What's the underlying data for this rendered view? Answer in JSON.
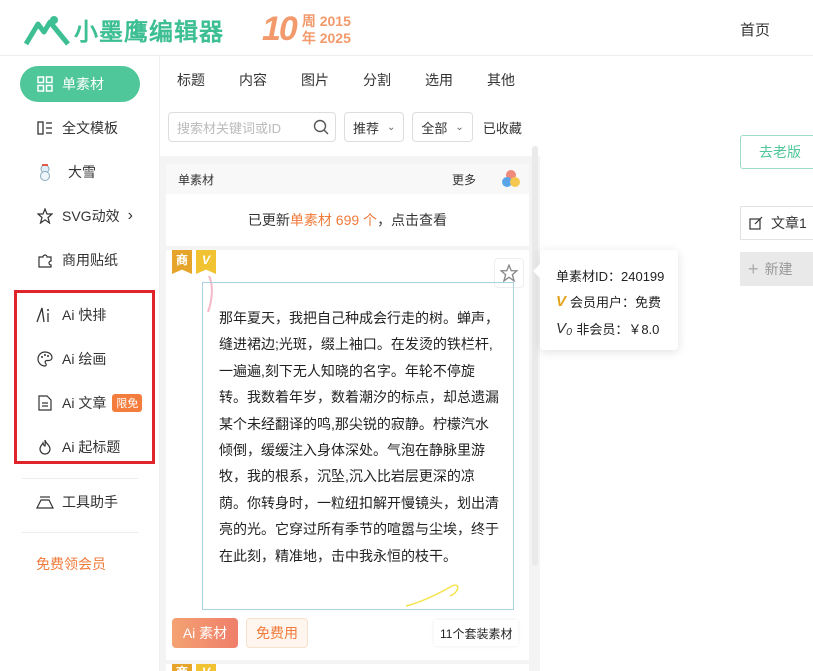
{
  "header": {
    "logo_text": "小墨鹰编辑器",
    "anniversary_number": "10",
    "anniversary_line1": "周 2015",
    "anniversary_line2": "年 2025",
    "home_link": "首页"
  },
  "sidebar": {
    "items": [
      {
        "label": "单素材",
        "icon": "grid-icon"
      },
      {
        "label": "全文模板",
        "icon": "template-icon"
      },
      {
        "label": "大雪",
        "icon": "snowman-icon"
      },
      {
        "label": "SVG动效",
        "icon": "star-outline-icon"
      },
      {
        "label": "商用贴纸",
        "icon": "puzzle-icon"
      },
      {
        "label": "Ai 快排",
        "icon": "ai-layout-icon"
      },
      {
        "label": "Ai 绘画",
        "icon": "palette-icon"
      },
      {
        "label": "Ai 文章",
        "icon": "document-icon",
        "badge": "限免"
      },
      {
        "label": "Ai 起标题",
        "icon": "flame-icon"
      },
      {
        "label": "工具助手",
        "icon": "toolbox-icon"
      }
    ],
    "svg_chevron": "›",
    "vip_link": "免费领会员"
  },
  "panel": {
    "tabs": [
      "标题",
      "内容",
      "图片",
      "分割",
      "选用",
      "其他"
    ],
    "search_placeholder": "搜索材关键词或ID",
    "sort_select": "推荐",
    "filter_select": "全部",
    "favorites": "已收藏",
    "list_title": "单素材",
    "more": "更多",
    "update_prefix": "已更新 ",
    "update_highlight": "单素材 699 个",
    "update_suffix": "，点击查看",
    "card": {
      "tag_commercial": "商",
      "tag_vip": "V",
      "text": "那年夏天，我把自己种成会行走的树。蝉声，缝进裙边;光斑，缀上袖口。在发烫的铁栏杆,一遍遍,刻下无人知晓的名字。年轮不停旋转。我数着年岁，数着潮汐的标点，却总遗漏某个未经翻译的鸣,那尖锐的寂静。柠檬汽水倾倒，缓缓注入身体深处。气泡在静脉里游牧，我的根系，沉坠,沉入比岩层更深的凉荫。你转身时，一粒纽扣解开慢镜头，划出清亮的光。它穿过所有季节的喧嚣与尘埃，终于在此刻，精准地，击中我永恒的枝干。",
      "ai_tag": "Ai 素材",
      "free_tag": "免费用",
      "set_tag": "11个套装素材"
    }
  },
  "tooltip": {
    "id_line": "单素材ID：240199",
    "member_mark": "V",
    "member_line": "会员用户：免费",
    "nonmember_mark": "V₀",
    "nonmember_line": "非会员：￥8.0"
  },
  "editor": {
    "old_version": "去老版",
    "doc_tab": "文章1",
    "new_doc": "新建"
  },
  "colors": {
    "brand_green": "#4fc79a",
    "accent_orange": "#f07a3a",
    "highlight_red": "#e0242b"
  }
}
